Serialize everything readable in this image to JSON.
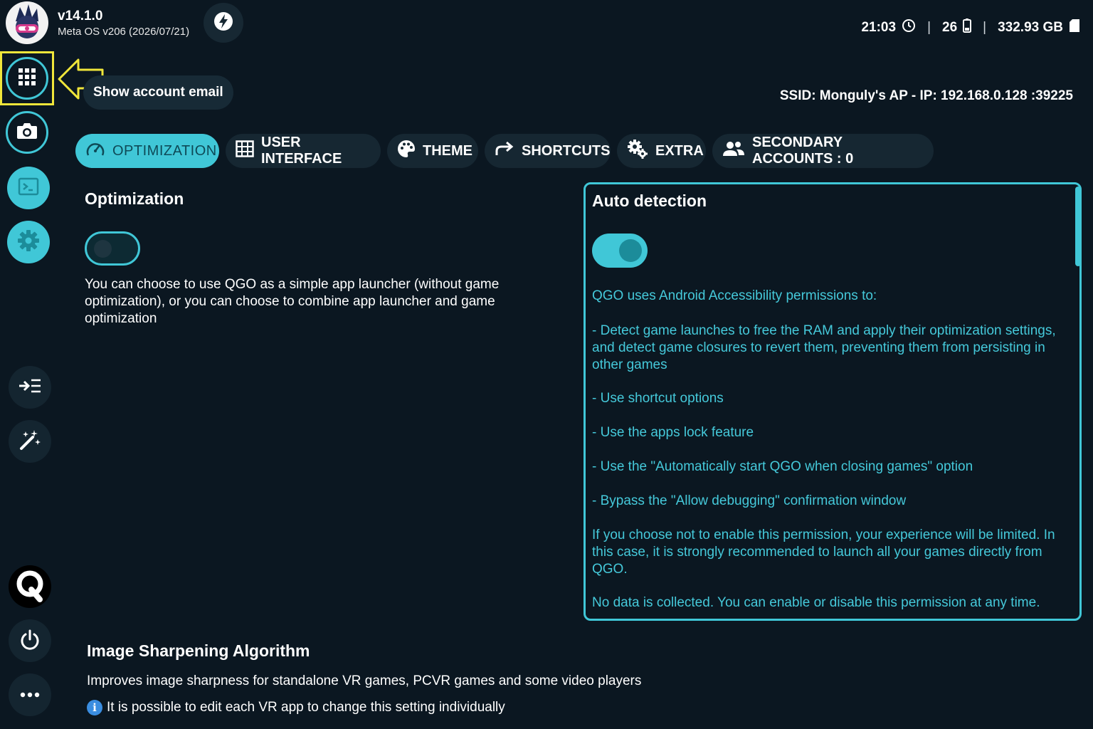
{
  "header": {
    "version": "v14.1.0",
    "os_line": "Meta OS v206 (2026/07/21)",
    "time": "21:03",
    "battery": "26",
    "storage": "332.93 GB",
    "network": "SSID: Monguly's AP - IP: 192.168.0.128 :39225"
  },
  "account": {
    "show_email_label": "Show account email"
  },
  "tabs": [
    {
      "label": "OPTIMIZATION",
      "icon": "gauge-icon",
      "active": true
    },
    {
      "label": "USER INTERFACE",
      "icon": "grid-icon",
      "active": false
    },
    {
      "label": "THEME",
      "icon": "palette-icon",
      "active": false
    },
    {
      "label": "SHORTCUTS",
      "icon": "share-arrow-icon",
      "active": false
    },
    {
      "label": "EXTRA",
      "icon": "gears-icon",
      "active": false
    },
    {
      "label": "SECONDARY ACCOUNTS : 0",
      "icon": "users-icon",
      "active": false
    }
  ],
  "optimization": {
    "title": "Optimization",
    "enabled": false,
    "description": "You can choose to use QGO as a simple app launcher (without game optimization), or you can choose to combine app launcher and game optimization"
  },
  "auto_detection": {
    "title": "Auto detection",
    "enabled": true,
    "intro": "QGO uses Android Accessibility permissions to:",
    "items": [
      "- Detect game launches to free the RAM and apply their optimization settings, and detect game closures to revert them, preventing them from persisting in other games",
      "- Use shortcut options",
      "- Use the apps lock feature",
      "- Use the \"Automatically start QGO when closing games\" option",
      "- Bypass the \"Allow debugging\" confirmation window"
    ],
    "warning": "If you choose not to enable this permission, your experience will be limited. In this case, it is strongly recommended to launch all your games directly from QGO.",
    "privacy": "No data is collected. You can enable or disable this permission at any time."
  },
  "image_sharpening": {
    "title": "Image Sharpening Algorithm",
    "description": "Improves image sharpness for standalone VR games, PCVR games and some video players",
    "note": "It is possible to edit each VR app to change this setting individually"
  },
  "sidebar": {
    "items": [
      "apps-grid-icon",
      "camera-icon",
      "terminal-icon",
      "settings-gear-icon",
      "indent-icon",
      "magic-wand-icon",
      "q-logo-icon",
      "power-icon",
      "more-icon"
    ]
  },
  "colors": {
    "accent": "#40c7d7",
    "background": "#0b1721",
    "highlight": "#f0e63a"
  }
}
